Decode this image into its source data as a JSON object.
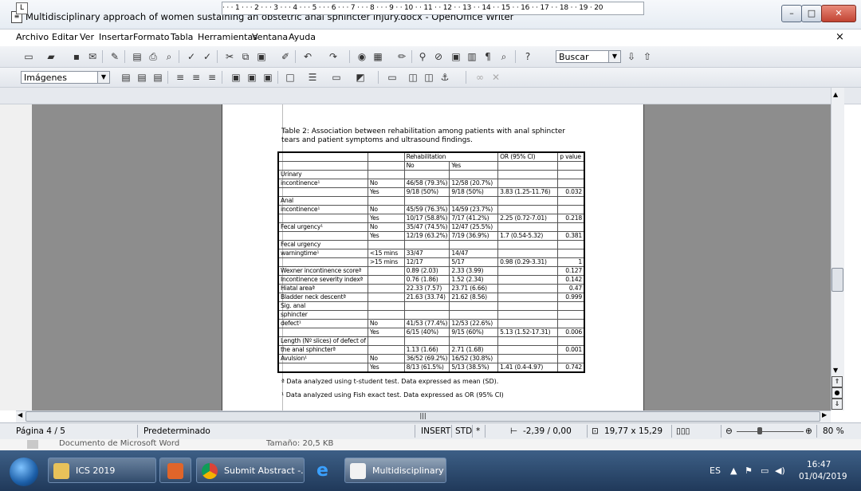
{
  "window": {
    "title": "Multidisciplinary approach of women sustaining an obstetric anal  sphincter injury.docx - OpenOffice Writer",
    "minimize": "–",
    "maximize": "□",
    "close": "✕"
  },
  "menu": [
    "Archivo",
    "Editar",
    "Ver",
    "Insertar",
    "Formato",
    "Tabla",
    "Herramientas",
    "Ventana",
    "Ayuda"
  ],
  "toolbar": {
    "search_label": "Buscar",
    "style_value": "Imágenes"
  },
  "ruler": "· · · 1 · · · 2 · · · 3 · · · 4 · · · 5 · · · 6 · · · 7 · · · 8 · · · 9 · · 10 · · 11 · · 12 · · 13 · · 14 · · 15 · · 16 · · 17 · · 18 · · 19 · 20",
  "document": {
    "caption": "Table 2: Association between rehabilitation among patients with anal sphincter tears and patient symptoms and ultrasound findings.",
    "header": {
      "rehab": "Rehabilitation",
      "or": "OR (95% CI)",
      "p": "p value",
      "no": "No",
      "yes": "Yes"
    },
    "rows": [
      {
        "v": "Urinary",
        "g": "",
        "no": "",
        "yes": "",
        "or": "",
        "p": ""
      },
      {
        "v": "incontinence¹",
        "g": "No",
        "no": "46/58 (79.3%)",
        "yes": "12/58 (20.7%)",
        "or": "",
        "p": ""
      },
      {
        "v": "",
        "g": "Yes",
        "no": "9/18 (50%)",
        "yes": "9/18 (50%)",
        "or": "3.83 (1.25-11.76)",
        "p": "0.032"
      },
      {
        "v": "Anal",
        "g": "",
        "no": "",
        "yes": "",
        "or": "",
        "p": ""
      },
      {
        "v": "incontinence¹",
        "g": "No",
        "no": "45/59 (76.3%)",
        "yes": "14/59 (23.7%)",
        "or": "",
        "p": ""
      },
      {
        "v": "",
        "g": "Yes",
        "no": "10/17 (58.8%)",
        "yes": "7/17 (41.2%)",
        "or": "2.25 (0.72-7.01)",
        "p": "0.218"
      },
      {
        "v": "Fecal urgency¹",
        "g": "No",
        "no": "35/47 (74.5%)",
        "yes": "12/47 (25.5%)",
        "or": "",
        "p": ""
      },
      {
        "v": "",
        "g": "Yes",
        "no": "12/19 (63.2%)",
        "yes": "7/19 (36.9%)",
        "or": "1.7 (0.54-5.32)",
        "p": "0.381"
      },
      {
        "v": "Fecal urgency",
        "g": "",
        "no": "",
        "yes": "",
        "or": "",
        "p": ""
      },
      {
        "v": "warningtime¹",
        "g": "<15 mins",
        "no": "33/47",
        "yes": "14/47",
        "or": "",
        "p": ""
      },
      {
        "v": "",
        "g": ">15 mins",
        "no": "12/17",
        "yes": "5/17",
        "or": "0.98 (0.29-3.31)",
        "p": "1"
      },
      {
        "v": "Wexner incontinence scoreª",
        "g": "",
        "no": "0.89 (2.03)",
        "yes": "2.33 (3.99)",
        "or": "",
        "p": "0.127"
      },
      {
        "v": "Incontinence severity indexª",
        "g": "",
        "no": "0.76 (1.86)",
        "yes": "1.52 (2.34)",
        "or": "",
        "p": "0.142"
      },
      {
        "v": "Hiatal areaª",
        "g": "",
        "no": "22.33 (7.57)",
        "yes": "23.71 (6.66)",
        "or": "",
        "p": "0.47"
      },
      {
        "v": "Bladder neck descentª",
        "g": "",
        "no": "21.63 (33.74)",
        "yes": "21.62 (8.56)",
        "or": "",
        "p": "0.999"
      },
      {
        "v": "Sig. anal",
        "g": "",
        "no": "",
        "yes": "",
        "or": "",
        "p": ""
      },
      {
        "v": "sphincter",
        "g": "",
        "no": "",
        "yes": "",
        "or": "",
        "p": ""
      },
      {
        "v": "defect¹",
        "g": "No",
        "no": "41/53 (77.4%)",
        "yes": "12/53 (22.6%)",
        "or": "",
        "p": ""
      },
      {
        "v": "",
        "g": "Yes",
        "no": "6/15 (40%)",
        "yes": "9/15 (60%)",
        "or": "5.13 (1.52-17.31)",
        "p": "0.006"
      },
      {
        "v": "Length (Nº slices) of defect of",
        "g": "",
        "no": "",
        "yes": "",
        "or": "",
        "p": ""
      },
      {
        "v": "the anal sphincterª",
        "g": "",
        "no": "1.13 (1.66)",
        "yes": "2.71 (1.68)",
        "or": "",
        "p": "0.001"
      },
      {
        "v": "Avulsion¹",
        "g": "No",
        "no": "36/52 (69.2%)",
        "yes": "16/52 (30.8%)",
        "or": "",
        "p": ""
      },
      {
        "v": "",
        "g": "Yes",
        "no": "8/13 (61.5%)",
        "yes": "5/13 (38.5%)",
        "or": "1.41 (0.4-4.97)",
        "p": "0.742"
      }
    ],
    "footnote1": "ª Data analyzed using t-student test. Data expressed as mean (SD).",
    "footnote2": "¹ Data analyzed using Fish exact test. Data expressed as OR (95% CI)"
  },
  "status": {
    "page": "Página  4 / 5",
    "style": "Predeterminado",
    "insert": "INSERT",
    "std": "STD",
    "star": "*",
    "position": "-2,39 / 0,00",
    "size": "19,77 x 15,29",
    "zoom": "80 %"
  },
  "behind": {
    "type": "Documento de Microsoft Word",
    "size": "Tamaño: 20,5 KB"
  },
  "taskbar": {
    "items": [
      "ICS 2019",
      "",
      "Submit Abstract -...",
      "",
      "Multidisciplinary ..."
    ],
    "lang": "ES",
    "time": "16:47",
    "date": "01/04/2019"
  }
}
